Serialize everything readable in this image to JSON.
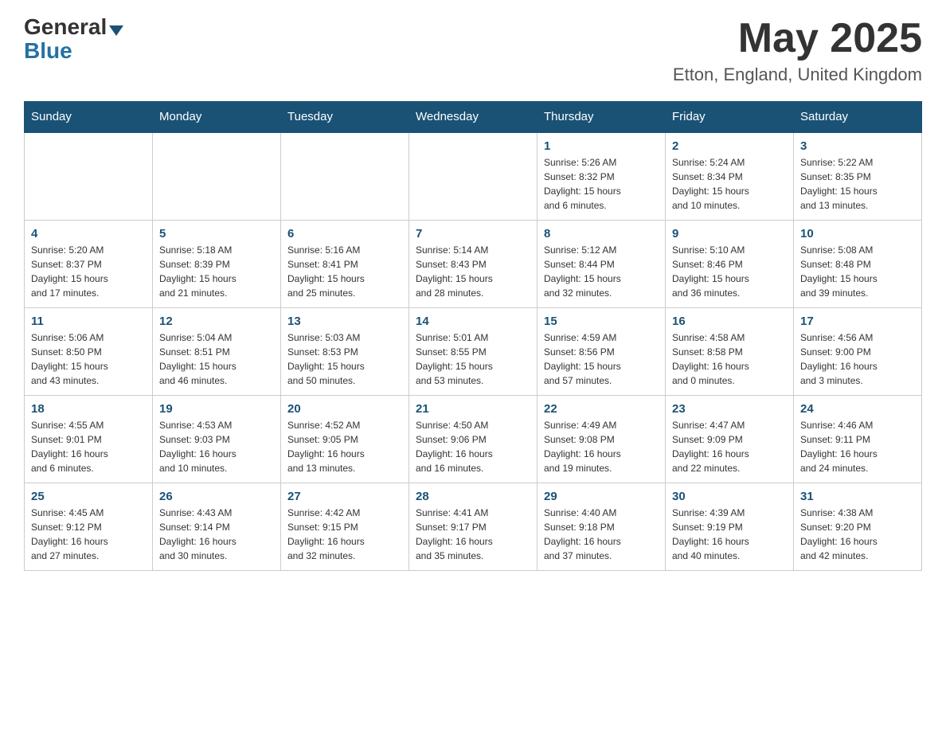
{
  "header": {
    "logo": {
      "general": "General",
      "blue": "Blue"
    },
    "title": "May 2025",
    "location": "Etton, England, United Kingdom"
  },
  "weekdays": [
    "Sunday",
    "Monday",
    "Tuesday",
    "Wednesday",
    "Thursday",
    "Friday",
    "Saturday"
  ],
  "weeks": [
    [
      {
        "day": "",
        "info": ""
      },
      {
        "day": "",
        "info": ""
      },
      {
        "day": "",
        "info": ""
      },
      {
        "day": "",
        "info": ""
      },
      {
        "day": "1",
        "info": "Sunrise: 5:26 AM\nSunset: 8:32 PM\nDaylight: 15 hours\nand 6 minutes."
      },
      {
        "day": "2",
        "info": "Sunrise: 5:24 AM\nSunset: 8:34 PM\nDaylight: 15 hours\nand 10 minutes."
      },
      {
        "day": "3",
        "info": "Sunrise: 5:22 AM\nSunset: 8:35 PM\nDaylight: 15 hours\nand 13 minutes."
      }
    ],
    [
      {
        "day": "4",
        "info": "Sunrise: 5:20 AM\nSunset: 8:37 PM\nDaylight: 15 hours\nand 17 minutes."
      },
      {
        "day": "5",
        "info": "Sunrise: 5:18 AM\nSunset: 8:39 PM\nDaylight: 15 hours\nand 21 minutes."
      },
      {
        "day": "6",
        "info": "Sunrise: 5:16 AM\nSunset: 8:41 PM\nDaylight: 15 hours\nand 25 minutes."
      },
      {
        "day": "7",
        "info": "Sunrise: 5:14 AM\nSunset: 8:43 PM\nDaylight: 15 hours\nand 28 minutes."
      },
      {
        "day": "8",
        "info": "Sunrise: 5:12 AM\nSunset: 8:44 PM\nDaylight: 15 hours\nand 32 minutes."
      },
      {
        "day": "9",
        "info": "Sunrise: 5:10 AM\nSunset: 8:46 PM\nDaylight: 15 hours\nand 36 minutes."
      },
      {
        "day": "10",
        "info": "Sunrise: 5:08 AM\nSunset: 8:48 PM\nDaylight: 15 hours\nand 39 minutes."
      }
    ],
    [
      {
        "day": "11",
        "info": "Sunrise: 5:06 AM\nSunset: 8:50 PM\nDaylight: 15 hours\nand 43 minutes."
      },
      {
        "day": "12",
        "info": "Sunrise: 5:04 AM\nSunset: 8:51 PM\nDaylight: 15 hours\nand 46 minutes."
      },
      {
        "day": "13",
        "info": "Sunrise: 5:03 AM\nSunset: 8:53 PM\nDaylight: 15 hours\nand 50 minutes."
      },
      {
        "day": "14",
        "info": "Sunrise: 5:01 AM\nSunset: 8:55 PM\nDaylight: 15 hours\nand 53 minutes."
      },
      {
        "day": "15",
        "info": "Sunrise: 4:59 AM\nSunset: 8:56 PM\nDaylight: 15 hours\nand 57 minutes."
      },
      {
        "day": "16",
        "info": "Sunrise: 4:58 AM\nSunset: 8:58 PM\nDaylight: 16 hours\nand 0 minutes."
      },
      {
        "day": "17",
        "info": "Sunrise: 4:56 AM\nSunset: 9:00 PM\nDaylight: 16 hours\nand 3 minutes."
      }
    ],
    [
      {
        "day": "18",
        "info": "Sunrise: 4:55 AM\nSunset: 9:01 PM\nDaylight: 16 hours\nand 6 minutes."
      },
      {
        "day": "19",
        "info": "Sunrise: 4:53 AM\nSunset: 9:03 PM\nDaylight: 16 hours\nand 10 minutes."
      },
      {
        "day": "20",
        "info": "Sunrise: 4:52 AM\nSunset: 9:05 PM\nDaylight: 16 hours\nand 13 minutes."
      },
      {
        "day": "21",
        "info": "Sunrise: 4:50 AM\nSunset: 9:06 PM\nDaylight: 16 hours\nand 16 minutes."
      },
      {
        "day": "22",
        "info": "Sunrise: 4:49 AM\nSunset: 9:08 PM\nDaylight: 16 hours\nand 19 minutes."
      },
      {
        "day": "23",
        "info": "Sunrise: 4:47 AM\nSunset: 9:09 PM\nDaylight: 16 hours\nand 22 minutes."
      },
      {
        "day": "24",
        "info": "Sunrise: 4:46 AM\nSunset: 9:11 PM\nDaylight: 16 hours\nand 24 minutes."
      }
    ],
    [
      {
        "day": "25",
        "info": "Sunrise: 4:45 AM\nSunset: 9:12 PM\nDaylight: 16 hours\nand 27 minutes."
      },
      {
        "day": "26",
        "info": "Sunrise: 4:43 AM\nSunset: 9:14 PM\nDaylight: 16 hours\nand 30 minutes."
      },
      {
        "day": "27",
        "info": "Sunrise: 4:42 AM\nSunset: 9:15 PM\nDaylight: 16 hours\nand 32 minutes."
      },
      {
        "day": "28",
        "info": "Sunrise: 4:41 AM\nSunset: 9:17 PM\nDaylight: 16 hours\nand 35 minutes."
      },
      {
        "day": "29",
        "info": "Sunrise: 4:40 AM\nSunset: 9:18 PM\nDaylight: 16 hours\nand 37 minutes."
      },
      {
        "day": "30",
        "info": "Sunrise: 4:39 AM\nSunset: 9:19 PM\nDaylight: 16 hours\nand 40 minutes."
      },
      {
        "day": "31",
        "info": "Sunrise: 4:38 AM\nSunset: 9:20 PM\nDaylight: 16 hours\nand 42 minutes."
      }
    ]
  ]
}
